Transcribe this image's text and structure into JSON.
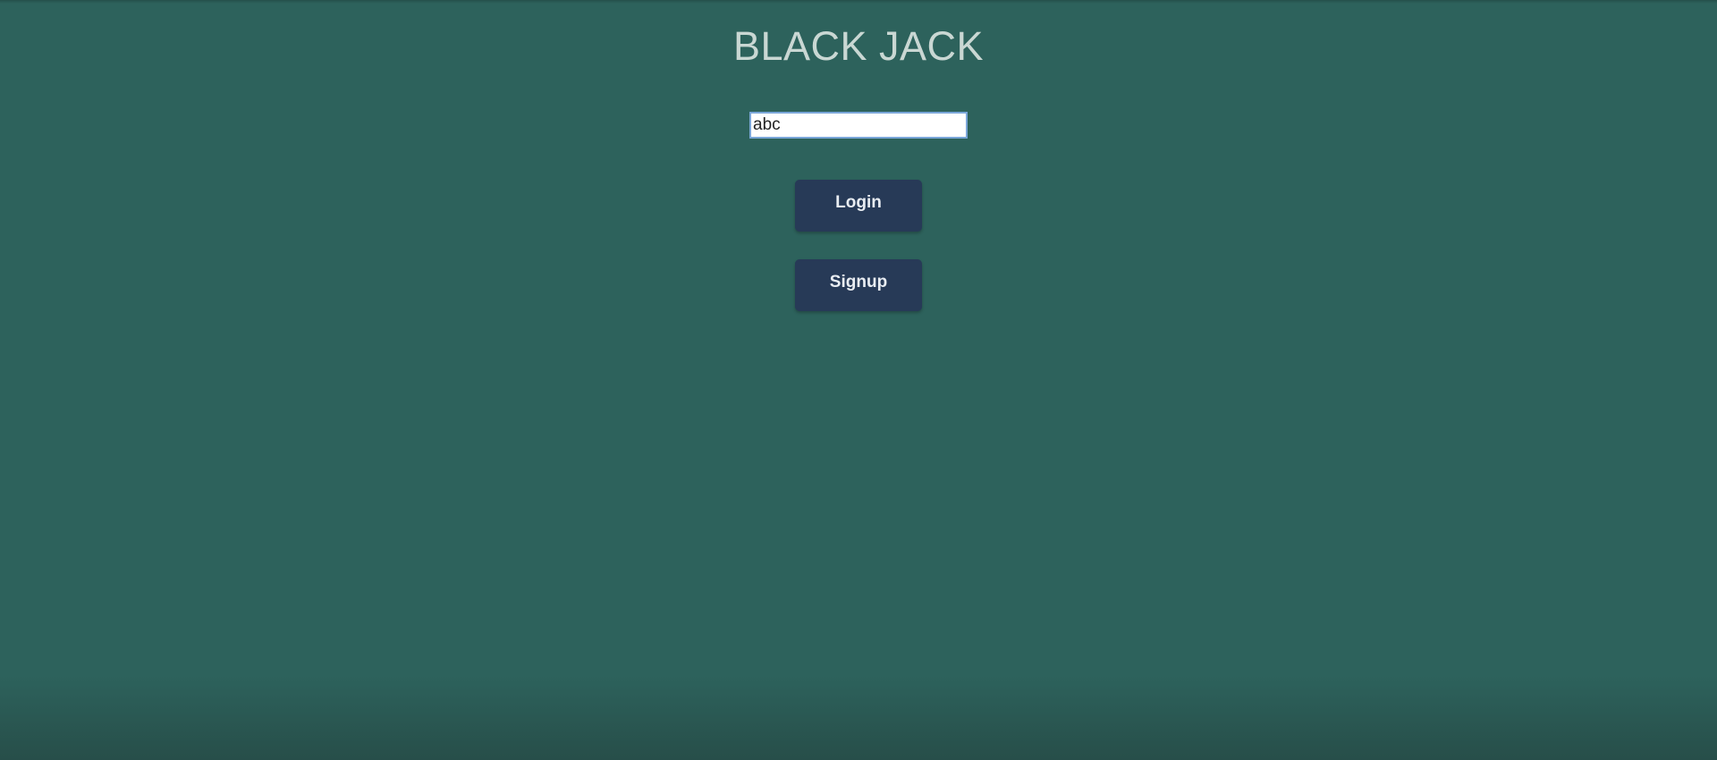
{
  "page": {
    "title": "BLACK JACK"
  },
  "login_form": {
    "username_value": "abc",
    "login_label": "Login",
    "signup_label": "Signup"
  },
  "colors": {
    "background": "#2d625c",
    "button": "#273a57",
    "title_text": "#c9d7d3"
  }
}
